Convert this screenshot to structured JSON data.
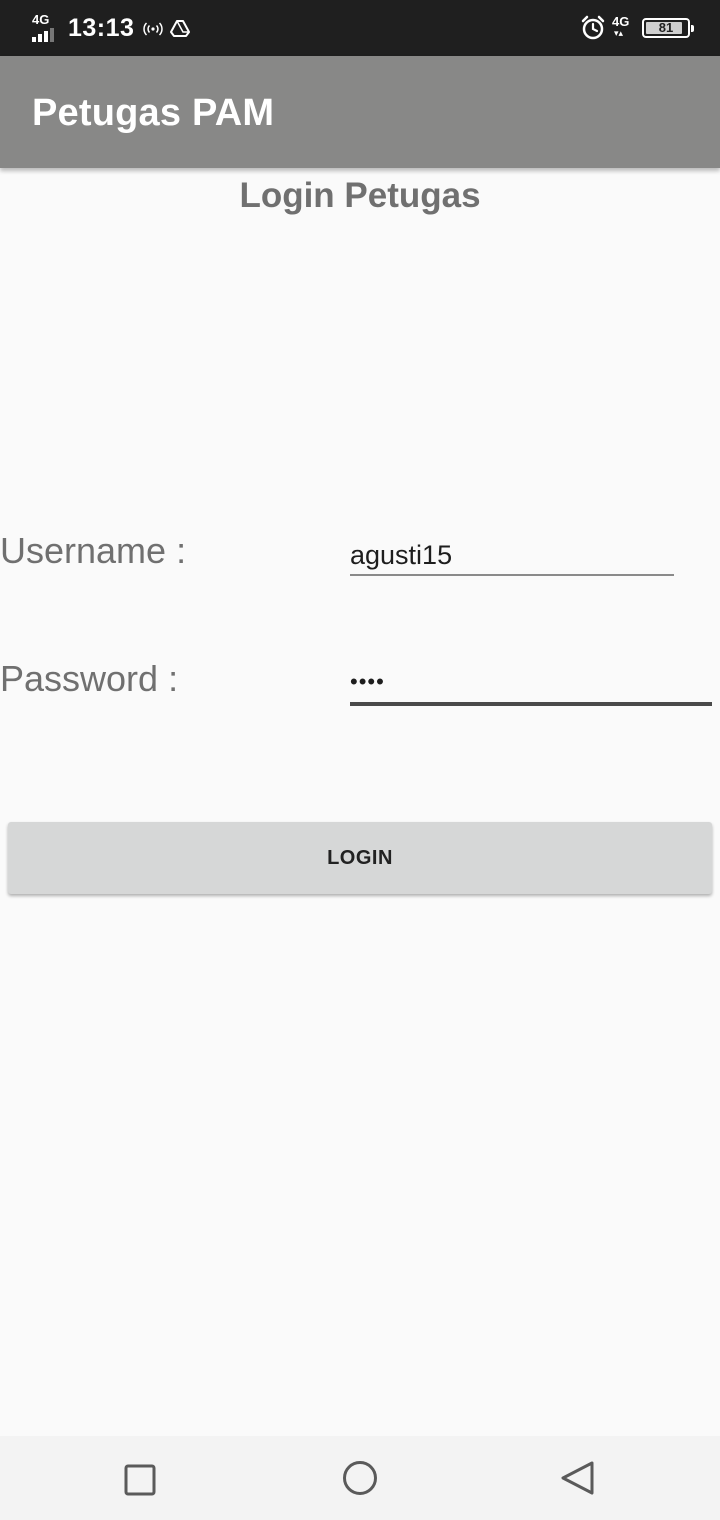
{
  "status_bar": {
    "network_label": "4G",
    "time": "13:13",
    "data_label": "4G",
    "battery_level": "81",
    "icons": [
      "signal-4g-icon",
      "hotspot-icon",
      "drive-icon",
      "alarm-icon",
      "mobile-data-4g-icon",
      "battery-icon"
    ]
  },
  "app_bar": {
    "title": "Petugas PAM",
    "background_color": "#888887"
  },
  "form": {
    "heading": "Login Petugas",
    "username_label": "Username :",
    "username_value": "agusti15",
    "password_label": "Password :",
    "password_value": "••••",
    "login_button": "LOGIN"
  },
  "nav_bar": {
    "icons": [
      "recents-icon",
      "home-icon",
      "back-icon"
    ]
  }
}
